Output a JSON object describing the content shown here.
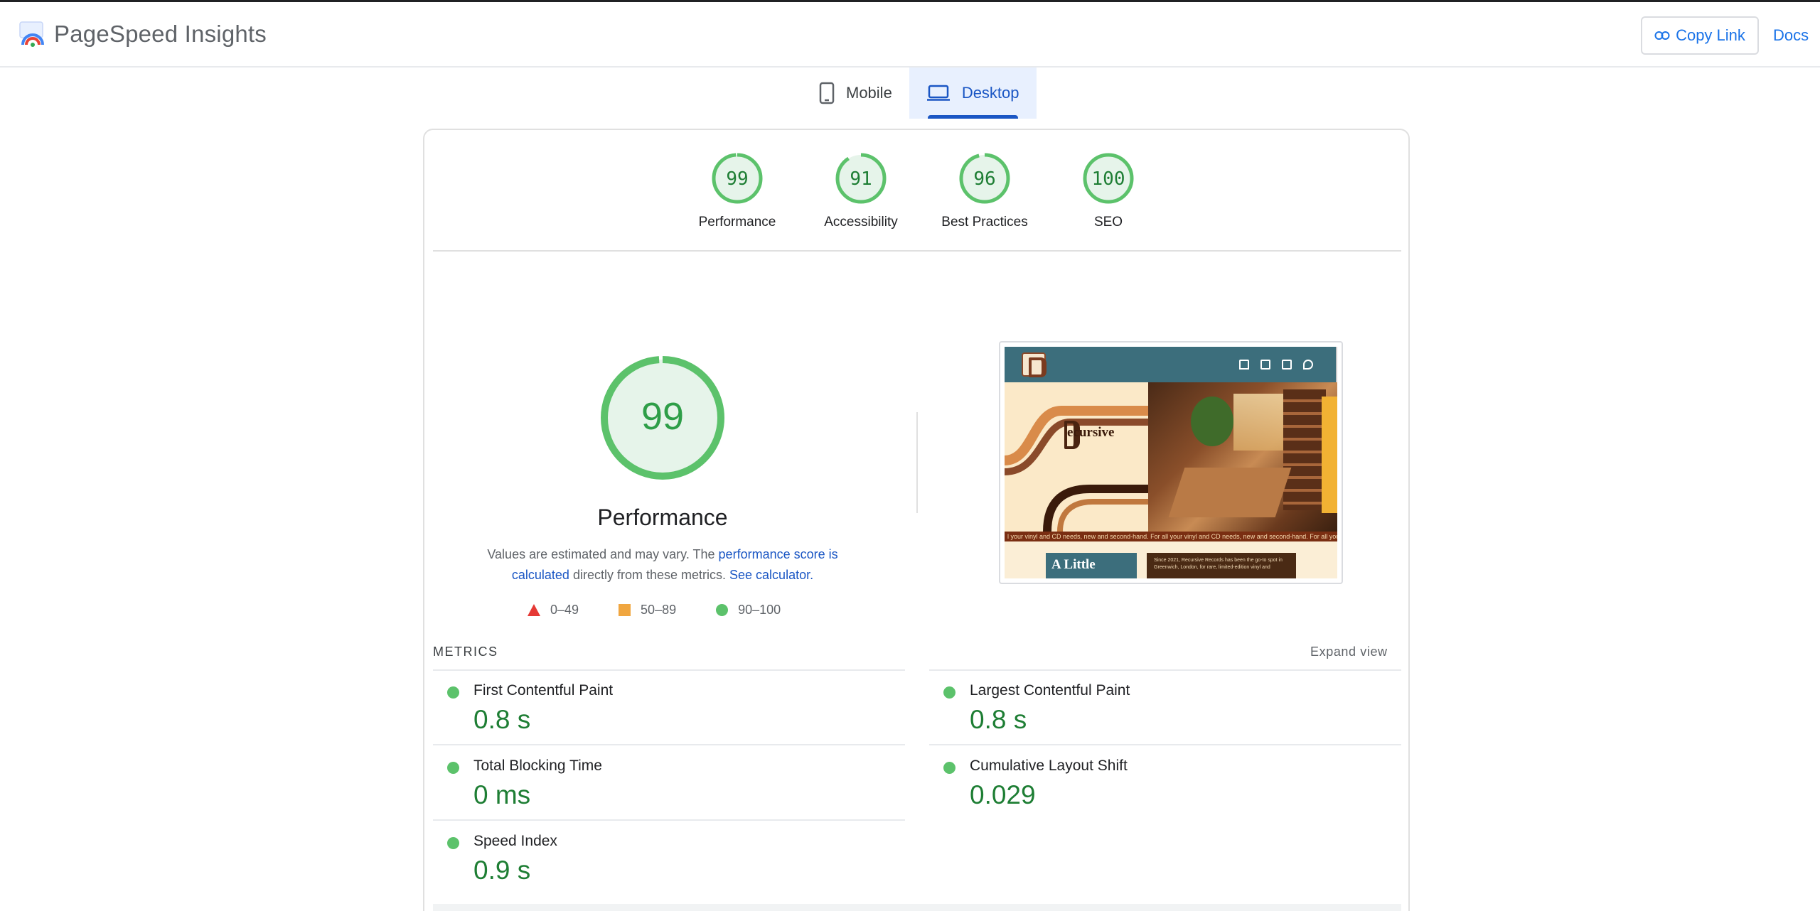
{
  "header": {
    "app_name": "PageSpeed Insights",
    "copy_link_label": "Copy Link",
    "docs_label": "Docs"
  },
  "tabs": [
    {
      "label": "Mobile",
      "icon": "smartphone-icon",
      "active": false
    },
    {
      "label": "Desktop",
      "icon": "laptop-icon",
      "active": true
    }
  ],
  "score_gauges": [
    {
      "score": "99",
      "label": "Performance",
      "value": 99
    },
    {
      "score": "91",
      "label": "Accessibility",
      "value": 91
    },
    {
      "score": "96",
      "label": "Best Practices",
      "value": 96
    },
    {
      "score": "100",
      "label": "SEO",
      "value": 100
    }
  ],
  "performance": {
    "score": "99",
    "value": 99,
    "title": "Performance",
    "note_prefix": "Values are estimated and may vary. The ",
    "note_link1": "performance score is calculated",
    "note_middle": " directly from these metrics. ",
    "note_link2": "See calculator.",
    "legend": [
      {
        "range": "0–49",
        "shape": "triangle",
        "color": "#e53935"
      },
      {
        "range": "50–89",
        "shape": "square",
        "color": "#f0a640"
      },
      {
        "range": "90–100",
        "shape": "circle",
        "color": "#5cc26b"
      }
    ]
  },
  "thumbnail": {
    "brand_text": "ecursive",
    "ticker_text": "l your vinyl and CD needs, new and second-hand.  For all your vinyl and CD needs, new and second-hand.  For all your vinyl and CD",
    "heading_text": "A Little",
    "about_text": "Since 2021, Recursive Records has been the go-to spot in Greenwich, London, for rare, limited-edition vinyl and"
  },
  "metrics": {
    "heading": "METRICS",
    "expand_label": "Expand view",
    "items": [
      {
        "name": "First Contentful Paint",
        "value": "0.8 s"
      },
      {
        "name": "Largest Contentful Paint",
        "value": "0.8 s"
      },
      {
        "name": "Total Blocking Time",
        "value": "0 ms"
      },
      {
        "name": "Cumulative Layout Shift",
        "value": "0.029"
      },
      {
        "name": "Speed Index",
        "value": "0.9 s"
      }
    ]
  },
  "colors": {
    "pass_green": "#5cc26b",
    "pass_text": "#1e7e34",
    "accent_blue": "#1a73e8"
  }
}
